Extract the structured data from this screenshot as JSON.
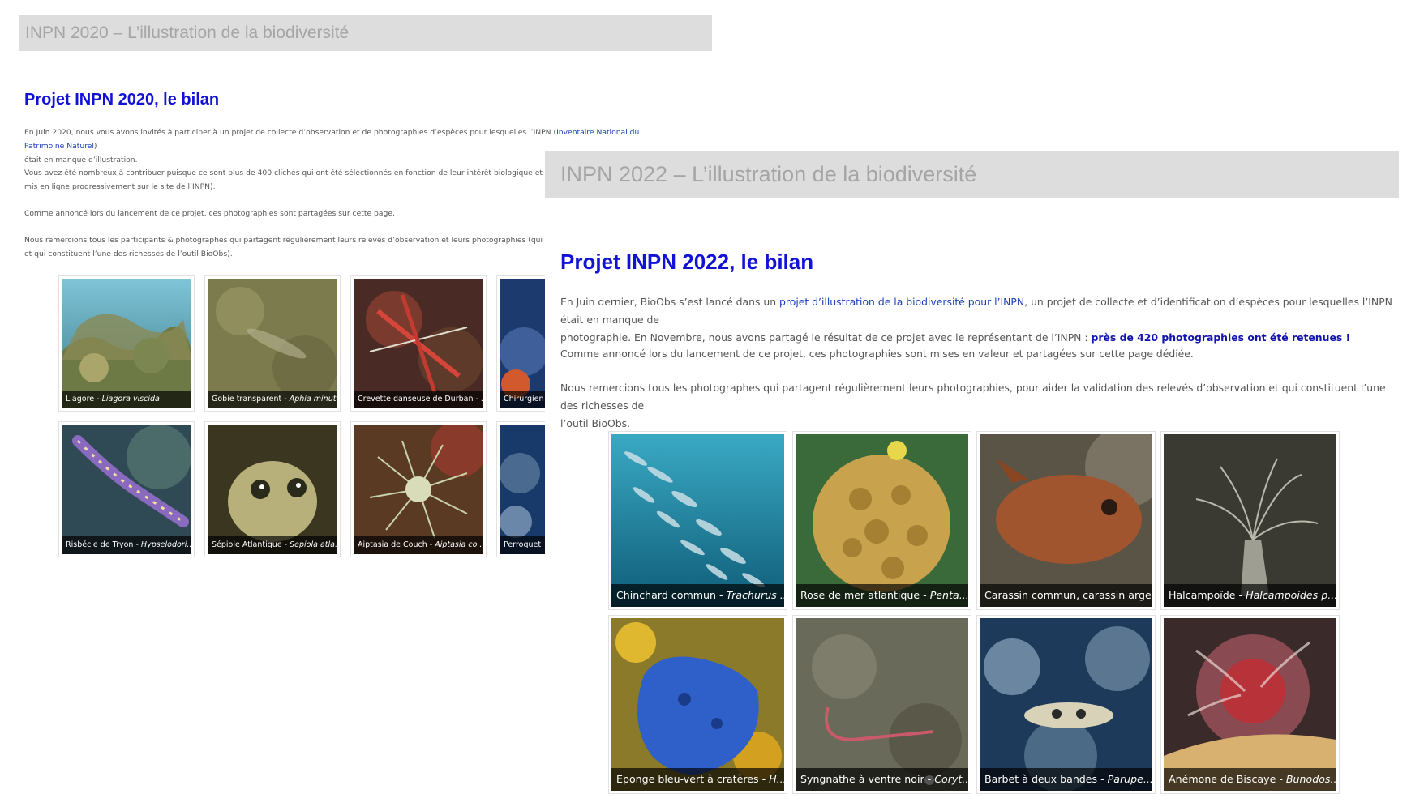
{
  "panel_2020": {
    "header_title": "INPN 2020 – L’illustration de la biodiversité",
    "subtitle": "Projet INPN 2020, le bilan",
    "p1_before": "En Juin 2020, nous vous avons invités à participer à un projet de collecte d’observation et de photographies d’espèces pour lesquelles l’INPN (",
    "p1_link": "Inventaire National du Patrimoine Naturel",
    "p1_after": ")",
    "p1_line2": "était en manque d’illustration.",
    "p2_line1": "Vous avez été nombreux à contribuer puisque ce sont plus de 400 clichés qui ont été sélectionnés en fonction de leur intérêt biologique et de leur q",
    "p2_line2": "mis en ligne progressivement sur le site de l’INPN).",
    "p3": "Comme annoncé lors du lancement de ce projet, ces photographies sont partagées sur cette page.",
    "p4_line1": "Nous remercions tous les participants & photographes qui partagent régulièrement leurs relevés d’observation et leurs photographies (qui aident la",
    "p4_line2": "et qui constituent l’une des richesses de l’outil BioObs).",
    "photos": [
      {
        "common": "Liagore - ",
        "latin": "Liagora viscida"
      },
      {
        "common": "Gobie transparent - ",
        "latin": "Aphia minuta"
      },
      {
        "common": "Crevette danseuse de Durban - ...",
        "latin": ""
      },
      {
        "common": "Chirurgien",
        "latin": ""
      },
      {
        "common": "Risbécie de Tryon - ",
        "latin": "Hypselodori..."
      },
      {
        "common": "Sépiole Atlantique - ",
        "latin": "Sepiola atla..."
      },
      {
        "common": "Aiptasia de Couch - ",
        "latin": "Aiptasia co..."
      },
      {
        "common": "Perroquet",
        "latin": ""
      }
    ]
  },
  "panel_2022": {
    "header_title": "INPN 2022 – L’illustration de la biodiversité",
    "subtitle": "Projet INPN 2022, le bilan",
    "p1_before": "En Juin dernier, BioObs s’est lancé dans un ",
    "p1_link": "projet d’illustration de la biodiversité pour l’INPN",
    "p1_after": ", un projet de collecte et d’identification d’espèces pour lesquelles l’INPN était en manque de",
    "p1_line2_before": "photographie. En Novembre, nous avons partagé le résultat de ce projet avec le représentant de l’INPN : ",
    "p1_line2_strong": "près de 420 photographies ont été retenues !",
    "p2": "Comme annoncé lors du lancement de ce projet, ces photographies sont mises en valeur et partagées sur cette page dédiée.",
    "p3_line1": "Nous remercions tous les photographes qui partagent régulièrement leurs photographies, pour aider la validation des relevés d’observation et qui constituent l’une des richesses de",
    "p3_line2": "l’outil BioObs.",
    "photos": [
      {
        "common": "Chinchard commun - ",
        "latin": "Trachurus ..."
      },
      {
        "common": "Rose de mer atlantique - ",
        "latin": "Penta..."
      },
      {
        "common": "Carassin commun, carassin arge...",
        "latin": ""
      },
      {
        "common": "Halcampoïde - ",
        "latin": "Halcampoides p..."
      },
      {
        "common": "Eponge bleu-vert à cratères - ",
        "latin": "H..."
      },
      {
        "common": "Syngnathe à ventre noir - ",
        "latin": "Coryt..."
      },
      {
        "common": "Barbet à deux bandes - ",
        "latin": "Parupe..."
      },
      {
        "common": "Anémone de Biscaye - ",
        "latin": "Bunodos..."
      }
    ]
  }
}
